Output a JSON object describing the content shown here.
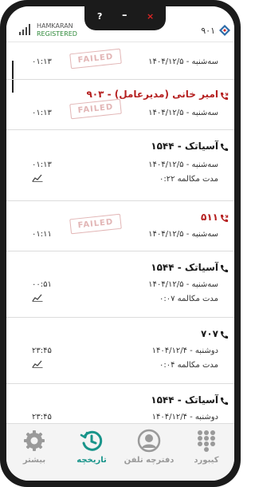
{
  "status": {
    "carrier": "HAMKARAN",
    "registration": "REGISTERED",
    "extension": "۹۰۱",
    "notch_buttons": [
      "?",
      "–",
      "×"
    ]
  },
  "history": {
    "top_partial": {
      "date": "سه‌شنبه - ۱۴۰۴/۱۲/۵",
      "time": "۰۱:۱۳"
    },
    "entries": [
      {
        "name": "امیر خانی (مدیرعامل) - ۹۰۳",
        "missed": true,
        "date": "سه‌شنبه - ۱۴۰۴/۱۲/۵",
        "duration": "",
        "time": "۰۱:۱۳",
        "stamp": "FAILED",
        "chart": false
      },
      {
        "name": "آسیاتک - ۱۵۴۴",
        "missed": false,
        "date": "سه‌شنبه - ۱۴۰۴/۱۲/۵",
        "duration": "مدت مکالمه ۰:۲۲",
        "time": "۰۱:۱۳",
        "stamp": "",
        "chart": true
      },
      {
        "name": "۵۱۱",
        "missed": true,
        "date": "سه‌شنبه - ۱۴۰۴/۱۲/۵",
        "duration": "",
        "time": "۰۱:۱۱",
        "stamp": "FAILED",
        "chart": false
      },
      {
        "name": "آسیاتک - ۱۵۴۴",
        "missed": false,
        "date": "سه‌شنبه - ۱۴۰۴/۱۲/۵",
        "duration": "مدت مکالمه ۰:۰۷",
        "time": "۰۰:۵۱",
        "stamp": "",
        "chart": true
      },
      {
        "name": "۷۰۷",
        "missed": false,
        "date": "دوشنبه - ۱۴۰۴/۱۲/۴",
        "duration": "مدت مکالمه ۰:۰۴",
        "time": "۲۳:۴۵",
        "stamp": "",
        "chart": true
      },
      {
        "name": "آسیاتک - ۱۵۴۴",
        "missed": false,
        "date": "دوشنبه - ۱۴۰۴/۱۲/۴",
        "duration": "",
        "time": "۲۳:۴۵",
        "stamp": "",
        "chart": false
      }
    ]
  },
  "nav": {
    "items": [
      {
        "label": "کیبورد",
        "icon": "keypad-icon",
        "active": false
      },
      {
        "label": "دفترچه تلفن",
        "icon": "contact-icon",
        "active": false
      },
      {
        "label": "تاریخچه",
        "icon": "history-icon",
        "active": true
      },
      {
        "label": "بیشتر",
        "icon": "gear-icon",
        "active": false
      }
    ]
  },
  "colors": {
    "accent": "#18948a",
    "missed": "#b51f1f",
    "registered": "#2f8a3a",
    "stamp": "#be5a5a"
  }
}
